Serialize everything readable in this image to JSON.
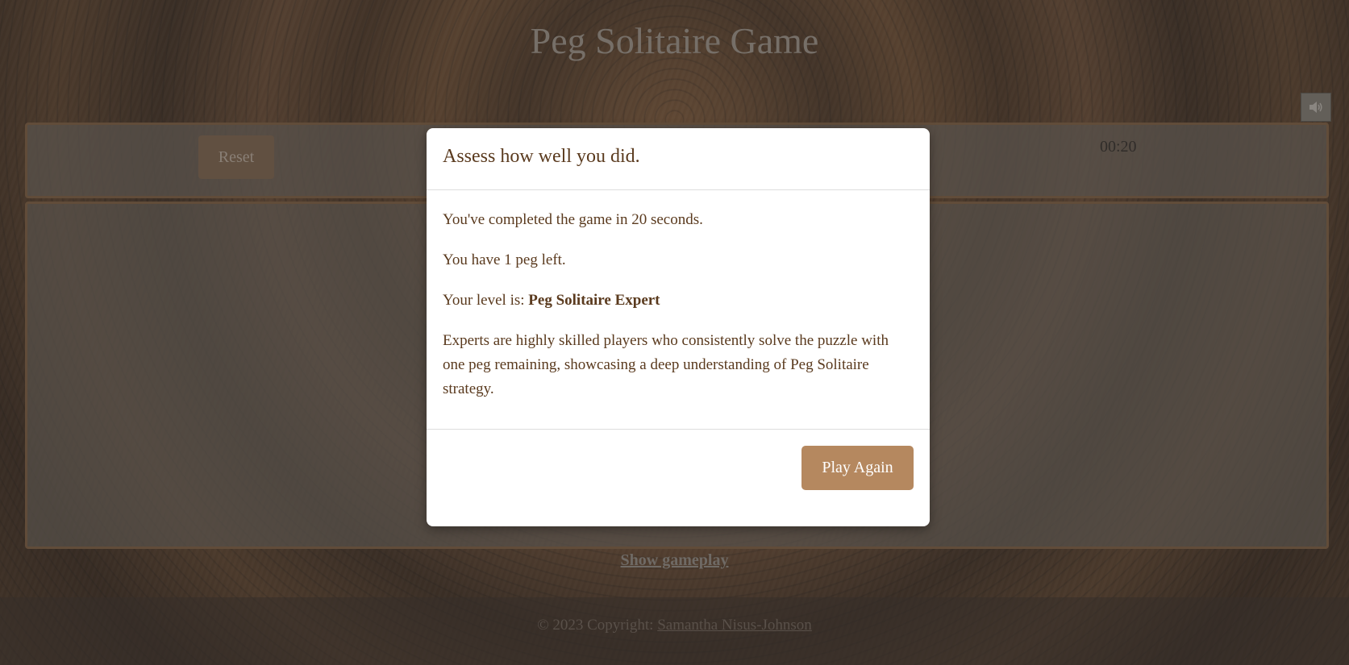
{
  "page": {
    "title": "Peg Solitaire Game"
  },
  "controls": {
    "reset_label": "Reset",
    "timer": "00:20",
    "sound_icon": "speaker-icon"
  },
  "links": {
    "show_gameplay": "Show gameplay"
  },
  "footer": {
    "copyright": "© 2023 Copyright: ",
    "author": "Samantha Nisus-Johnson"
  },
  "modal": {
    "title": "Assess how well you did.",
    "completed_text": "You've completed the game in 20 seconds.",
    "pegs_left_text": "You have 1 peg left.",
    "level_prefix": "Your level is: ",
    "level_value": "Peg Solitaire Expert",
    "description": "Experts are highly skilled players who consistently solve the puzzle with one peg remaining, showcasing a deep understanding of Peg Solitaire strategy.",
    "play_again_label": "Play Again"
  },
  "colors": {
    "accent": "#b5885f",
    "text_brown": "#5a3a1e"
  }
}
